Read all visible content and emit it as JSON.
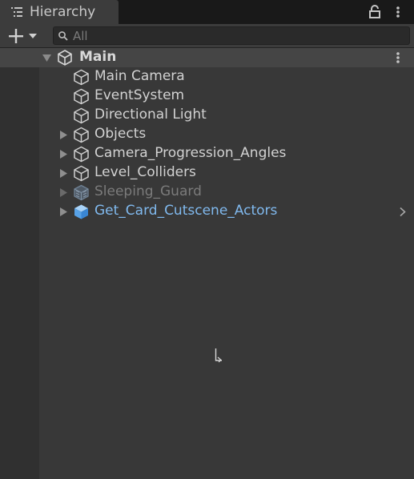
{
  "tab": {
    "title": "Hierarchy",
    "icon": "hierarchy-list-icon"
  },
  "toolbar": {
    "search_placeholder": "All"
  },
  "scene": {
    "name": "Main"
  },
  "items": [
    {
      "label": "Main Camera",
      "expandable": false,
      "state": "normal"
    },
    {
      "label": "EventSystem",
      "expandable": false,
      "state": "normal"
    },
    {
      "label": "Directional Light",
      "expandable": false,
      "state": "normal"
    },
    {
      "label": "Objects",
      "expandable": true,
      "state": "normal"
    },
    {
      "label": "Camera_Progression_Angles",
      "expandable": true,
      "state": "normal"
    },
    {
      "label": "Level_Colliders",
      "expandable": true,
      "state": "normal"
    },
    {
      "label": "Sleeping_Guard",
      "expandable": true,
      "state": "inactive"
    },
    {
      "label": "Get_Card_Cutscene_Actors",
      "expandable": true,
      "state": "prefab"
    }
  ],
  "colors": {
    "prefab_text": "#80b9ee",
    "inactive_text": "#7b7b7b",
    "panel_bg": "#383838",
    "scene_row_bg": "#454545"
  }
}
